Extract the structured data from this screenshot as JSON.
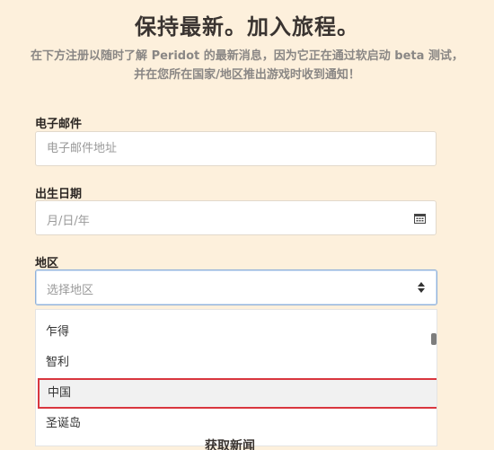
{
  "header": {
    "title": "保持最新。加入旅程。",
    "subtitle": "在下方注册以随时了解 Peridot 的最新消息，因为它正在通过软启动 beta 测试，并在您所在国家/地区推出游戏时收到通知！"
  },
  "email": {
    "label": "电子邮件",
    "placeholder": "电子邮件地址",
    "value": ""
  },
  "birthdate": {
    "label": "出生日期",
    "placeholder": "月/日/年",
    "icon": "calendar-icon"
  },
  "region": {
    "label": "地区",
    "placeholder": "选择地区",
    "icon": "sort-arrows-icon",
    "options": [
      "乍得",
      "智利",
      "中国",
      "圣诞岛"
    ],
    "highlighted": "中国",
    "highlight_color": "#d9363e"
  },
  "footer": {
    "partial_text": "获取新闻"
  }
}
